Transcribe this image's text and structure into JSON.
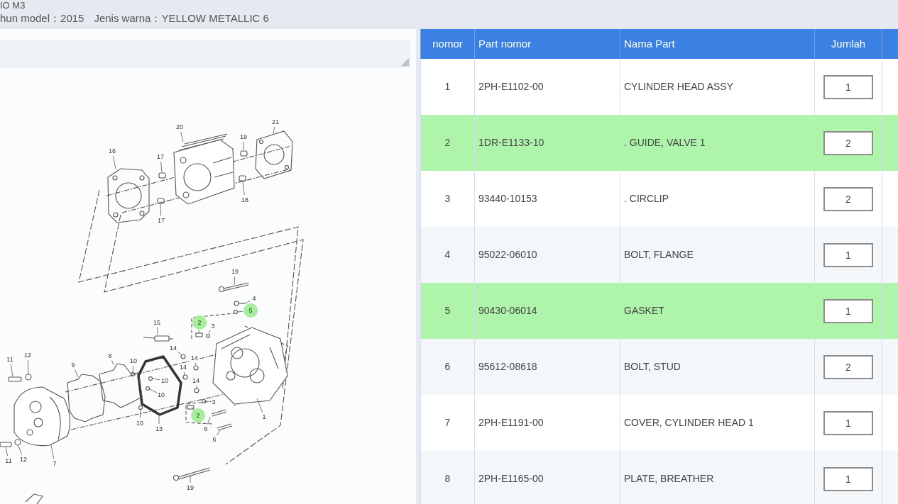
{
  "header": {
    "title": "IO M3",
    "model_year": "hun model：2015",
    "color_name": "Jenis warna：YELLOW METALLIC 6"
  },
  "diagram": {
    "callouts": [
      {
        "label": "21",
        "highlighted": false
      },
      {
        "label": "20",
        "highlighted": false
      },
      {
        "label": "19",
        "highlighted": false
      },
      {
        "label": "16",
        "highlighted": false
      },
      {
        "label": "17",
        "highlighted": false
      },
      {
        "label": "18",
        "highlighted": false
      },
      {
        "label": "17",
        "highlighted": false
      },
      {
        "label": "19",
        "highlighted": false
      },
      {
        "label": "4",
        "highlighted": false
      },
      {
        "label": "5",
        "highlighted": true
      },
      {
        "label": "2",
        "highlighted": true
      },
      {
        "label": "15",
        "highlighted": false
      },
      {
        "label": "3",
        "highlighted": false
      },
      {
        "label": "14",
        "highlighted": false
      },
      {
        "label": "12",
        "highlighted": false
      },
      {
        "label": "8",
        "highlighted": false
      },
      {
        "label": "11",
        "highlighted": false
      },
      {
        "label": "14",
        "highlighted": false
      },
      {
        "label": "10",
        "highlighted": false
      },
      {
        "label": "9",
        "highlighted": false
      },
      {
        "label": "14",
        "highlighted": false
      },
      {
        "label": "14",
        "highlighted": false
      },
      {
        "label": "10",
        "highlighted": false
      },
      {
        "label": "10",
        "highlighted": false
      },
      {
        "label": "3",
        "highlighted": false
      },
      {
        "label": "2",
        "highlighted": true
      },
      {
        "label": "1",
        "highlighted": false
      },
      {
        "label": "10",
        "highlighted": false
      },
      {
        "label": "13",
        "highlighted": false
      },
      {
        "label": "6",
        "highlighted": false
      },
      {
        "label": "6",
        "highlighted": false
      },
      {
        "label": "12",
        "highlighted": false
      },
      {
        "label": "11",
        "highlighted": false
      },
      {
        "label": "7",
        "highlighted": false
      },
      {
        "label": "19",
        "highlighted": false
      }
    ]
  },
  "table": {
    "columns": [
      "nomor",
      "Part nomor",
      "Nama Part",
      "Jumlah"
    ],
    "rows": [
      {
        "nomor": "1",
        "part_nomor": "2PH-E1102-00",
        "nama_part": "CYLINDER HEAD ASSY",
        "jumlah": "1",
        "selected": false
      },
      {
        "nomor": "2",
        "part_nomor": "1DR-E1133-10",
        "nama_part": ". GUIDE, VALVE 1",
        "jumlah": "2",
        "selected": true
      },
      {
        "nomor": "3",
        "part_nomor": "93440-10153",
        "nama_part": ". CIRCLIP",
        "jumlah": "2",
        "selected": false
      },
      {
        "nomor": "4",
        "part_nomor": "95022-06010",
        "nama_part": "BOLT, FLANGE",
        "jumlah": "1",
        "selected": false
      },
      {
        "nomor": "5",
        "part_nomor": "90430-06014",
        "nama_part": "GASKET",
        "jumlah": "1",
        "selected": true
      },
      {
        "nomor": "6",
        "part_nomor": "95612-08618",
        "nama_part": "BOLT, STUD",
        "jumlah": "2",
        "selected": false
      },
      {
        "nomor": "7",
        "part_nomor": "2PH-E1191-00",
        "nama_part": "COVER, CYLINDER HEAD 1",
        "jumlah": "1",
        "selected": false
      },
      {
        "nomor": "8",
        "part_nomor": "2PH-E1165-00",
        "nama_part": "PLATE, BREATHER",
        "jumlah": "1",
        "selected": false
      }
    ]
  }
}
